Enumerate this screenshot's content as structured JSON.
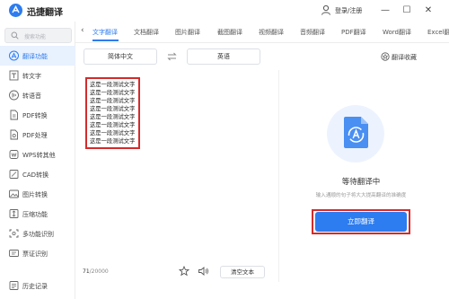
{
  "app": {
    "title": "迅捷翻译",
    "user_label": "登录/注册"
  },
  "window": {
    "minimize": "—",
    "maximize": "☐",
    "close": "✕"
  },
  "sidebar": {
    "search_placeholder": "搜索功能",
    "items": [
      {
        "label": "翻译功能",
        "icon": "translate-icon",
        "active": true
      },
      {
        "label": "转文字",
        "icon": "text-icon"
      },
      {
        "label": "转语音",
        "icon": "voice-icon"
      },
      {
        "label": "PDF转换",
        "icon": "pdf-convert-icon"
      },
      {
        "label": "PDF处理",
        "icon": "pdf-process-icon"
      },
      {
        "label": "WPS转其他",
        "icon": "wps-icon"
      },
      {
        "label": "CAD转换",
        "icon": "cad-icon"
      },
      {
        "label": "图片转换",
        "icon": "image-icon"
      },
      {
        "label": "压缩功能",
        "icon": "compress-icon"
      },
      {
        "label": "多功能识别",
        "icon": "recognize-icon"
      },
      {
        "label": "票证识别",
        "icon": "ticket-icon"
      },
      {
        "label": "历史记录",
        "icon": "history-icon"
      }
    ]
  },
  "tabs": [
    {
      "label": "文字翻译",
      "active": true
    },
    {
      "label": "文档翻译"
    },
    {
      "label": "图片翻译"
    },
    {
      "label": "截图翻译"
    },
    {
      "label": "视频翻译"
    },
    {
      "label": "音频翻译"
    },
    {
      "label": "PDF翻译"
    },
    {
      "label": "Word翻译"
    },
    {
      "label": "Excel翻"
    }
  ],
  "language": {
    "source": "简体中文",
    "target": "英语",
    "collection_label": "翻译收藏"
  },
  "source": {
    "lines": [
      "这是一段测试文字",
      "这是一段测试文字",
      "这是一段测试文字",
      "这是一段测试文字",
      "这是一段测试文字",
      "这是一段测试文字",
      "这是一段测试文字",
      "这是一段测试文字"
    ],
    "char_count": "71",
    "char_limit": "/20000",
    "clear_label": "清空文本"
  },
  "result": {
    "waiting_title": "等待翻译中",
    "waiting_desc": "输入通顺的句子将大大提高翻译的准确度",
    "translate_label": "立即翻译"
  },
  "colors": {
    "accent": "#2d7cf0",
    "highlight": "#d42b2b"
  }
}
